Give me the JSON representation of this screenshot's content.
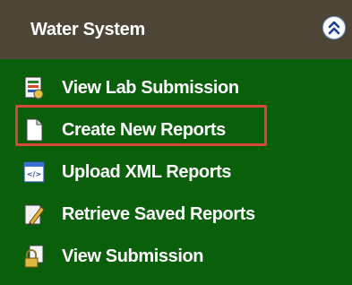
{
  "header": {
    "title": "Water System",
    "collapse_icon": "double-chevron-up-icon"
  },
  "menu": {
    "items": [
      {
        "label": "View Lab Submission",
        "icon": "lab-report-icon"
      },
      {
        "label": "Create New Reports",
        "icon": "blank-document-icon",
        "highlighted": true
      },
      {
        "label": "Upload XML Reports",
        "icon": "xml-file-icon"
      },
      {
        "label": "Retrieve Saved Reports",
        "icon": "pencil-document-icon"
      },
      {
        "label": "View Submission",
        "icon": "locked-document-icon"
      }
    ]
  },
  "colors": {
    "header_bg": "#4d4535",
    "panel_bg": "#0a5f0a",
    "text": "#ffffff",
    "highlight_border": "#d9463a"
  }
}
